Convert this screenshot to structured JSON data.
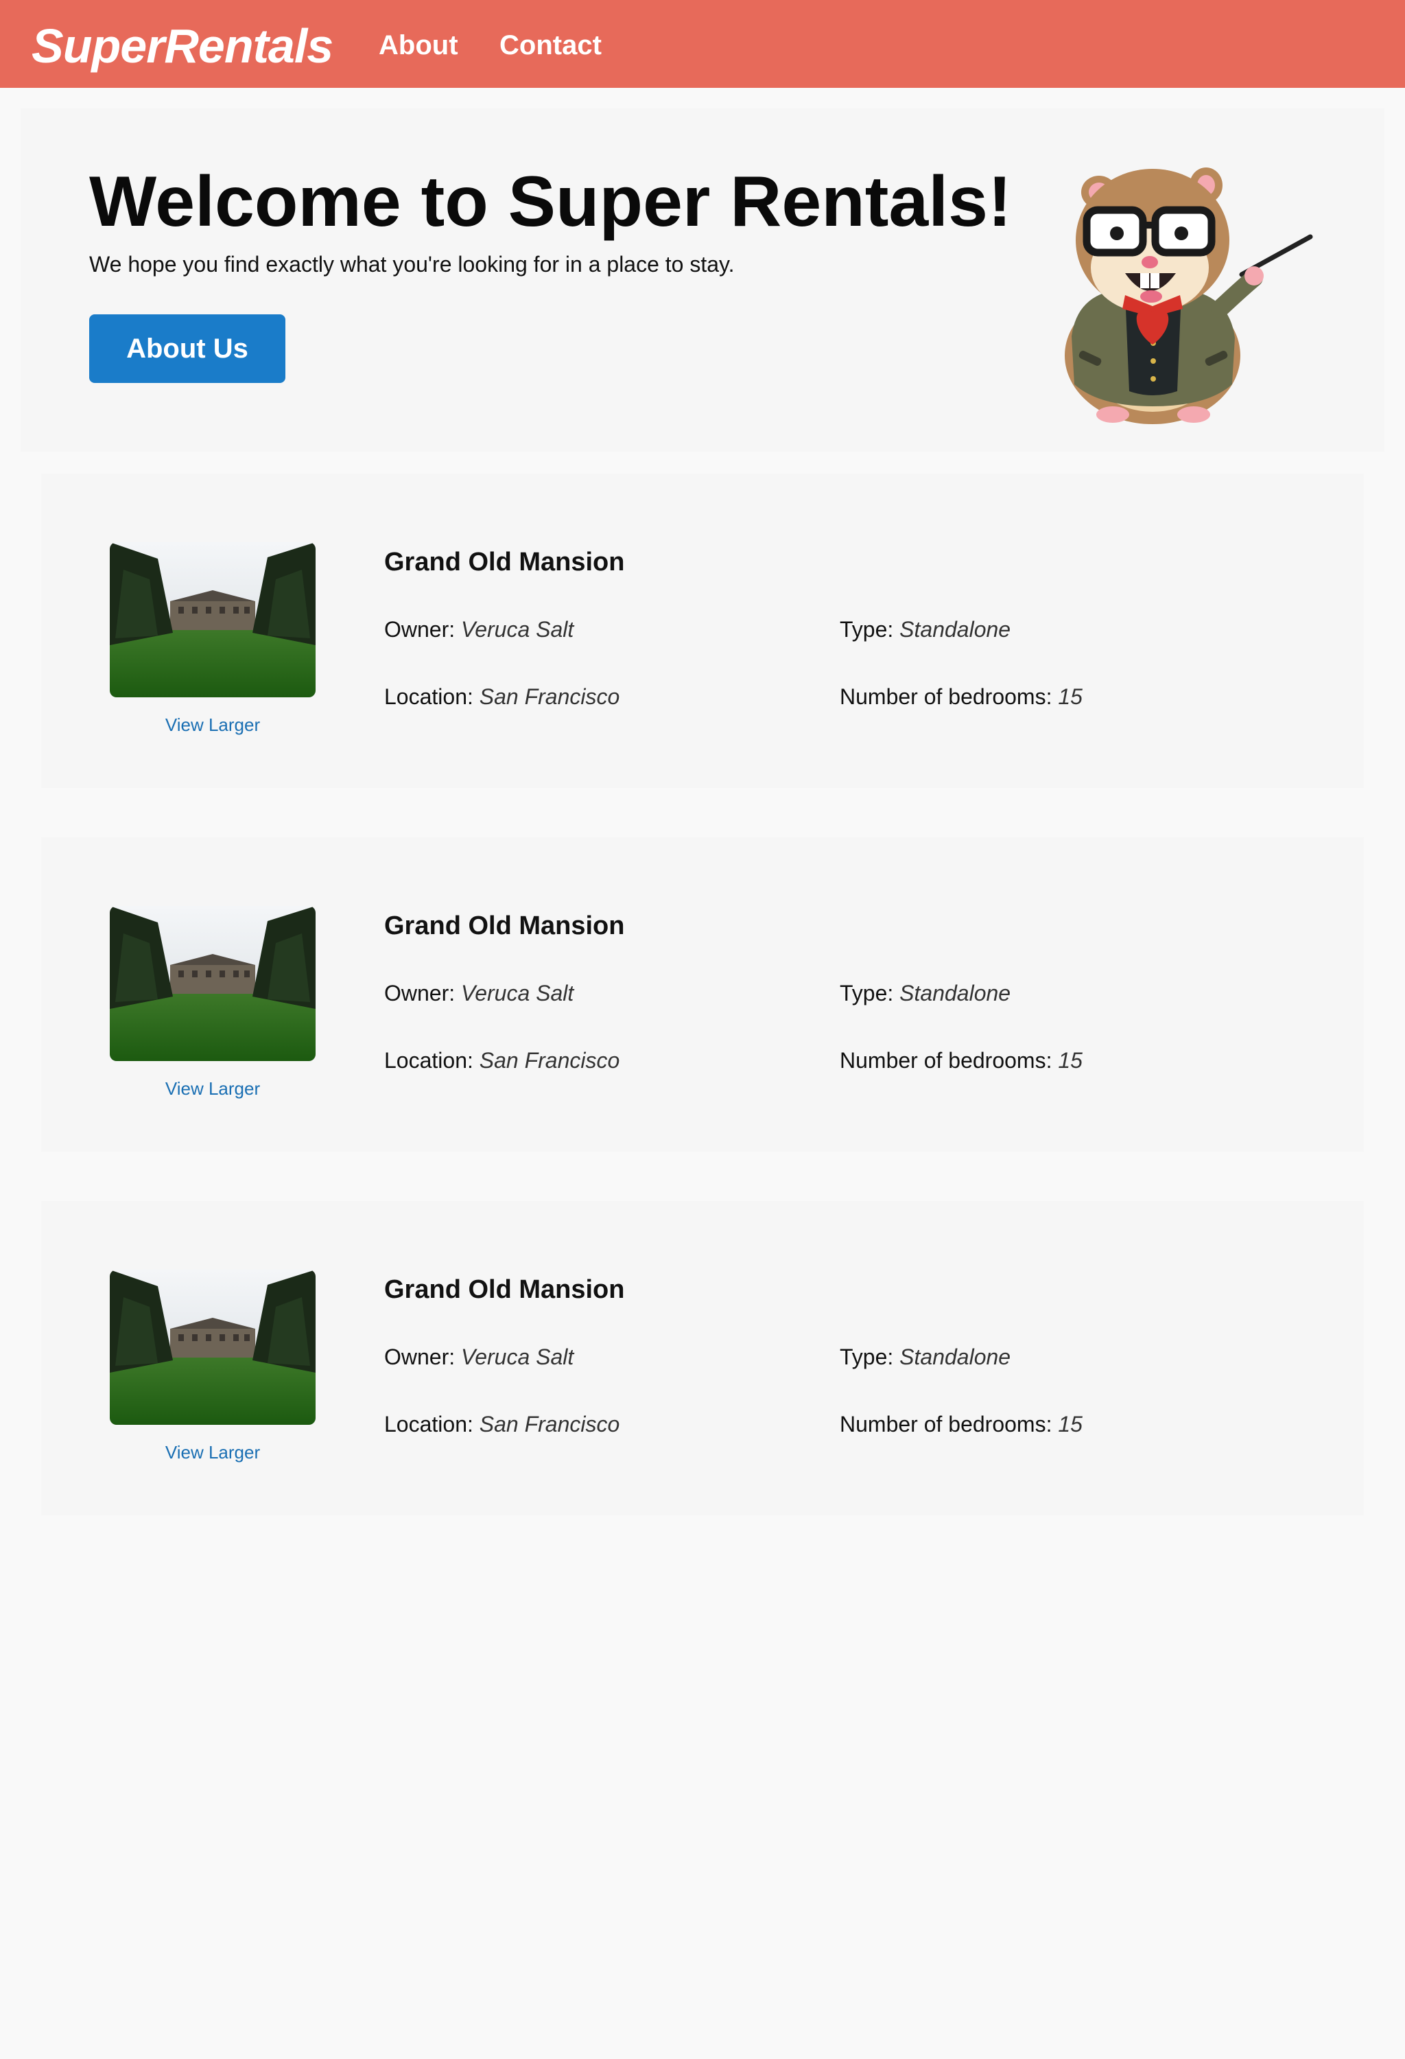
{
  "nav": {
    "logo": "SuperRentals",
    "links": [
      {
        "label": "About"
      },
      {
        "label": "Contact"
      }
    ],
    "bar_color": "#e76a5a"
  },
  "jumbo": {
    "title": "Welcome to Super Rentals!",
    "subtitle": "We hope you find exactly what you're looking for in a place to stay.",
    "button_label": "About Us",
    "button_color": "#1a7cc9",
    "mascot_icon": "tomster-hamster-icon"
  },
  "rentals": [
    {
      "title": "Grand Old Mansion",
      "owner_label": "Owner:",
      "owner": "Veruca Salt",
      "type_label": "Type:",
      "type": "Standalone",
      "location_label": "Location:",
      "location": "San Francisco",
      "bedrooms_label": "Number of bedrooms:",
      "bedrooms": "15",
      "view_larger": "View Larger"
    },
    {
      "title": "Grand Old Mansion",
      "owner_label": "Owner:",
      "owner": "Veruca Salt",
      "type_label": "Type:",
      "type": "Standalone",
      "location_label": "Location:",
      "location": "San Francisco",
      "bedrooms_label": "Number of bedrooms:",
      "bedrooms": "15",
      "view_larger": "View Larger"
    },
    {
      "title": "Grand Old Mansion",
      "owner_label": "Owner:",
      "owner": "Veruca Salt",
      "type_label": "Type:",
      "type": "Standalone",
      "location_label": "Location:",
      "location": "San Francisco",
      "bedrooms_label": "Number of bedrooms:",
      "bedrooms": "15",
      "view_larger": "View Larger"
    }
  ]
}
